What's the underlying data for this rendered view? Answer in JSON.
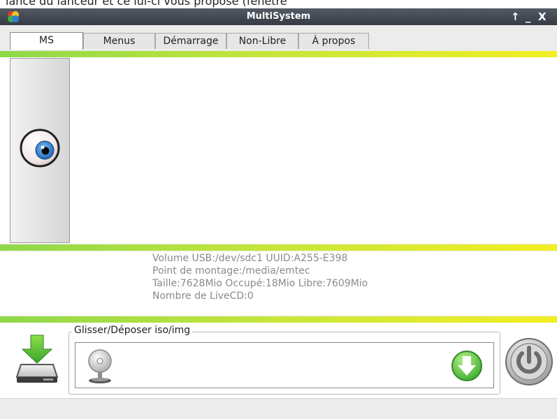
{
  "background_text": "lancé du lanceur et ce lui-ci vous proposé (fenêtre",
  "window": {
    "title": "MultiSystem",
    "controls": {
      "pin": "↑",
      "minimize": "_",
      "close": "X"
    }
  },
  "tabs": [
    {
      "label": "MS",
      "active": true
    },
    {
      "label": "Menus"
    },
    {
      "label": "Démarrage"
    },
    {
      "label": "Non-Libre"
    },
    {
      "label": "À propos"
    }
  ],
  "usb_info": {
    "volume": "Volume USB:/dev/sdc1 UUID:A255-E398",
    "mount": "Point de montage:/media/emtec",
    "size": "Taille:7628Mio Occupé:18Mio Libre:7609Mio",
    "livecd": "Nombre de LiveCD:0"
  },
  "dropzone": {
    "label": "Glisser/Déposer iso/img"
  },
  "colors": {
    "band_start": "#8ed84a",
    "band_end": "#f2ef22",
    "titlebar": "#3d434c",
    "download_green": "#4cc94a"
  },
  "icons": [
    "app-icon",
    "eye-icon",
    "usb-drive-icon",
    "cd-drive-icon",
    "download-arrow-icon",
    "power-icon"
  ]
}
